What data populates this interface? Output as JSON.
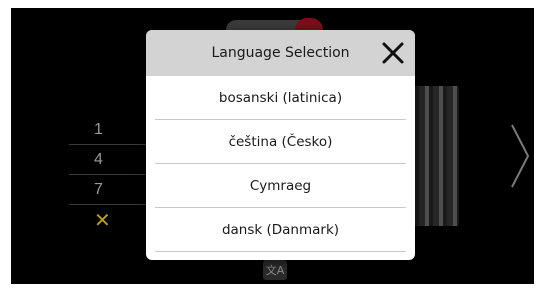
{
  "modal": {
    "title": "Language Selection",
    "languages": [
      "bosanski (latinica)",
      "čeština (Česko)",
      "Cymraeg",
      "dansk (Danmark)"
    ]
  },
  "keypad": {
    "keys": [
      "1",
      "4",
      "7",
      "✕"
    ]
  },
  "footer": {
    "translate_icon_label": "文A"
  },
  "colors": {
    "screen_background": "#000000",
    "modal_header": "#d3d3d3",
    "cancel_key": "#b5983d",
    "brand_accent": "#7a0f1a"
  },
  "icons": {
    "close": "close-icon",
    "next": "chevron-right-icon",
    "translate": "translate-icon"
  }
}
